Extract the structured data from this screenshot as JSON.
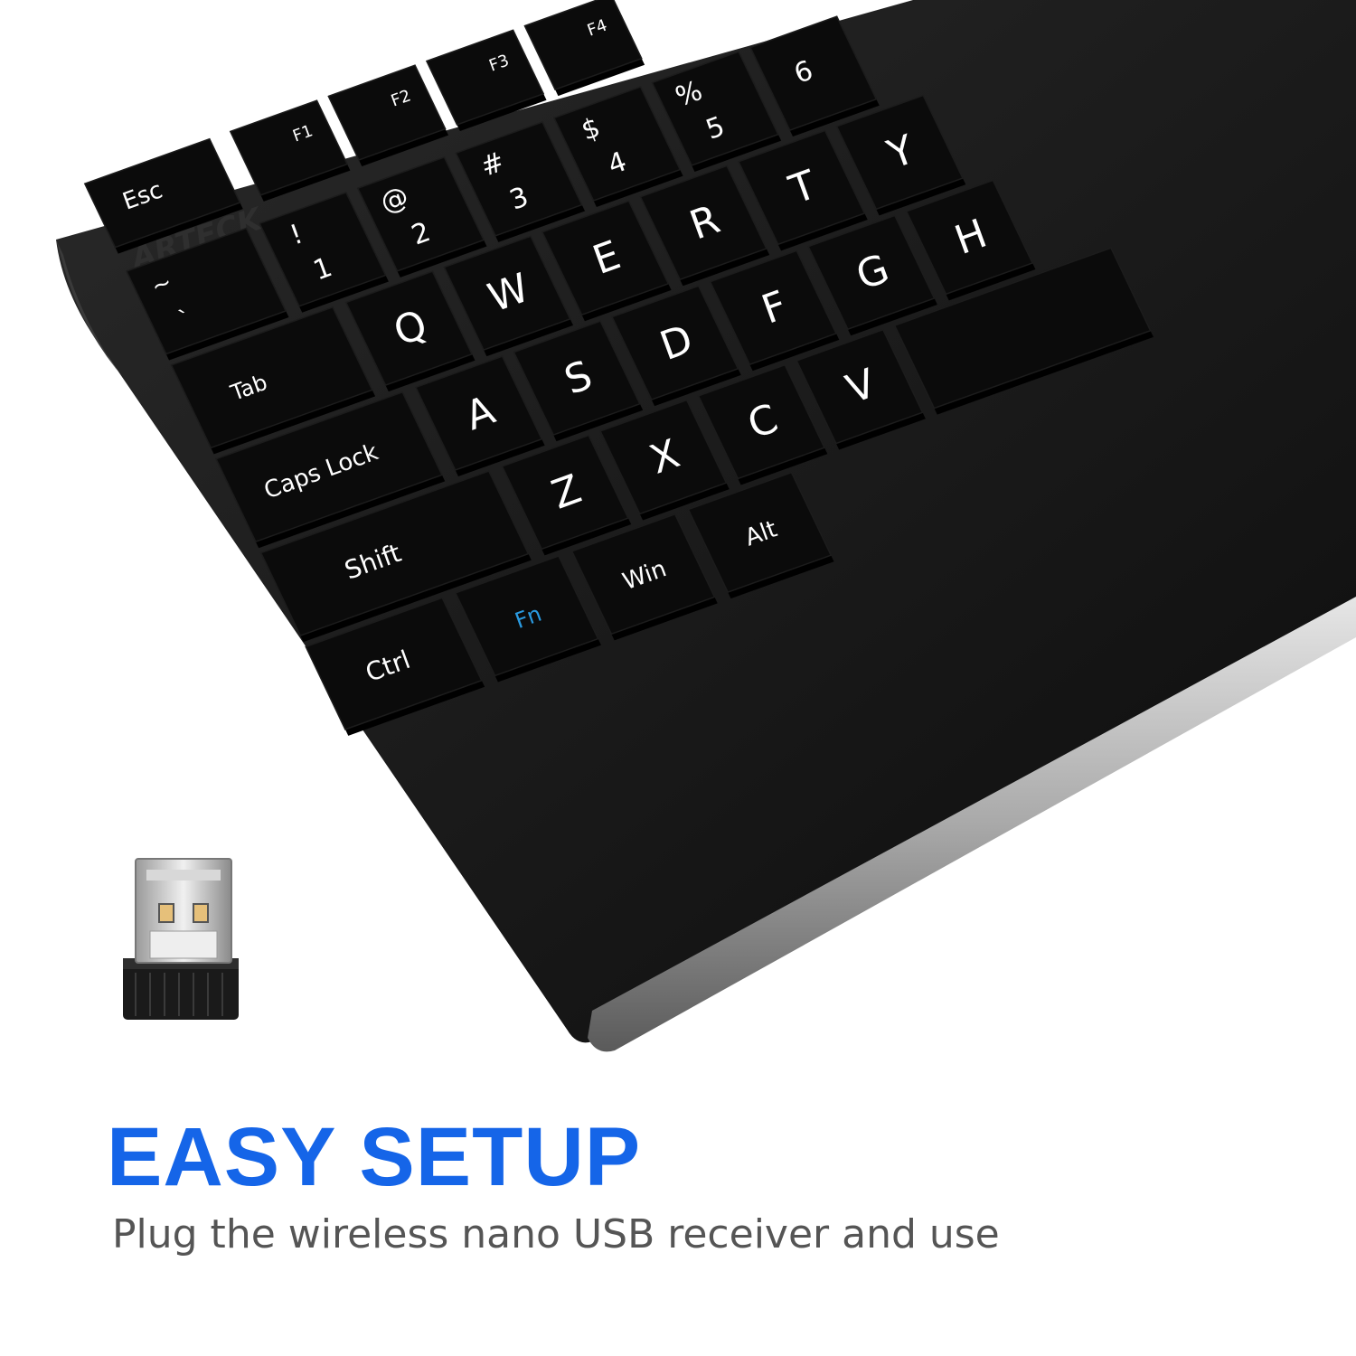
{
  "brand": "ARTECK",
  "headline": "EASY SETUP",
  "subheadline": "Plug the wireless nano USB receiver and use",
  "colors": {
    "headline": "#1565e8",
    "subheadline": "#555555",
    "keycap": "#0b0b0b",
    "legend": "#ffffff",
    "fn_legend": "#2a9ae0",
    "chassis": "#121212",
    "trim": "#b8b8b8"
  },
  "keys": {
    "esc": "Esc",
    "f1": "F1",
    "f2": "F2",
    "f3": "F3",
    "f4": "F4",
    "f1_icon": "mute-icon",
    "f2_icon": "volume-down-icon",
    "f3_icon": "volume-up-icon",
    "f4_icon": "previous-track-icon",
    "tilde_top": "~",
    "tilde_bottom": "`",
    "n1_top": "!",
    "n1_bottom": "1",
    "n2_top": "@",
    "n2_bottom": "2",
    "n3_top": "#",
    "n3_bottom": "3",
    "n4_top": "$",
    "n4_bottom": "4",
    "n5_top": "%",
    "n5_bottom": "5",
    "n6": "6",
    "tab": "Tab",
    "q": "Q",
    "w": "W",
    "e": "E",
    "r": "R",
    "t": "T",
    "y": "Y",
    "caps": "Caps Lock",
    "a": "A",
    "s": "S",
    "d": "D",
    "f": "F",
    "g": "G",
    "h": "H",
    "shift": "Shift",
    "z": "Z",
    "x": "X",
    "c": "C",
    "v": "V",
    "ctrl": "Ctrl",
    "fn": "Fn",
    "win": "Win",
    "alt": "Alt"
  }
}
